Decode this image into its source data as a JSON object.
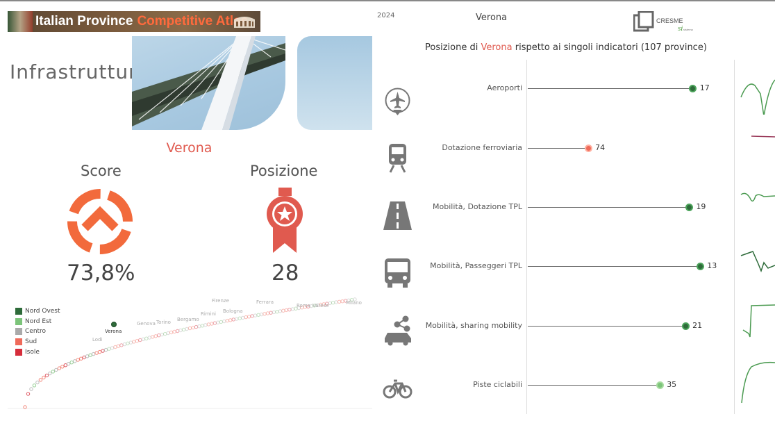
{
  "header": {
    "banner_title_white": "Italian Province",
    "banner_title_orange": "Competitive Atlas",
    "year": "2024",
    "province": "Verona",
    "logo_text": "CRESME"
  },
  "left": {
    "section_title": "Infrastrutture",
    "province_name": "Verona",
    "score_label": "Score",
    "score_value": "73,8%",
    "position_label": "Posizione",
    "position_value": "28"
  },
  "legend": [
    {
      "label": "Nord Ovest",
      "color": "#2e6b3a"
    },
    {
      "label": "Nord Est",
      "color": "#7cc47a"
    },
    {
      "label": "Centro",
      "color": "#aaaaaa"
    },
    {
      "label": "Sud",
      "color": "#ef6a5a"
    },
    {
      "label": "Isole",
      "color": "#d62d3b"
    }
  ],
  "scatter_labels": [
    {
      "text": "Verona"
    },
    {
      "text": "Lodi"
    },
    {
      "text": "Genova"
    },
    {
      "text": "Torino"
    },
    {
      "text": "Bergamo"
    },
    {
      "text": "Rimini"
    },
    {
      "text": "Bologna"
    },
    {
      "text": "Firenze"
    },
    {
      "text": "Ferrara"
    },
    {
      "text": "Roma"
    },
    {
      "text": "Varese"
    },
    {
      "text": "Milano"
    }
  ],
  "right": {
    "title_prefix": "Posizione di",
    "title_province": "Verona",
    "title_suffix": "rispetto ai singoli indicatori (107 province)",
    "indicators": [
      {
        "label": "Aeroporti",
        "rank": 17,
        "color": "#2e6b3a",
        "icon": "airplane-icon"
      },
      {
        "label": "Dotazione ferroviaria",
        "rank": 74,
        "color": "#ef6a5a",
        "icon": "train-icon"
      },
      {
        "label": "Mobilità, Dotazione TPL",
        "rank": 19,
        "color": "#2e6b3a",
        "icon": "road-icon"
      },
      {
        "label": "Mobilità, Passeggeri TPL",
        "rank": 13,
        "color": "#2e6b3a",
        "icon": "bus-icon"
      },
      {
        "label": "Mobilità, sharing mobility",
        "rank": 21,
        "color": "#2e6b3a",
        "icon": "car-sharing-icon"
      },
      {
        "label": "Piste ciclabili",
        "rank": 35,
        "color": "#7cc47a",
        "icon": "bicycle-icon"
      }
    ]
  },
  "colors": {
    "accent": "#ff6a3d",
    "highlight": "#e05a4f"
  }
}
